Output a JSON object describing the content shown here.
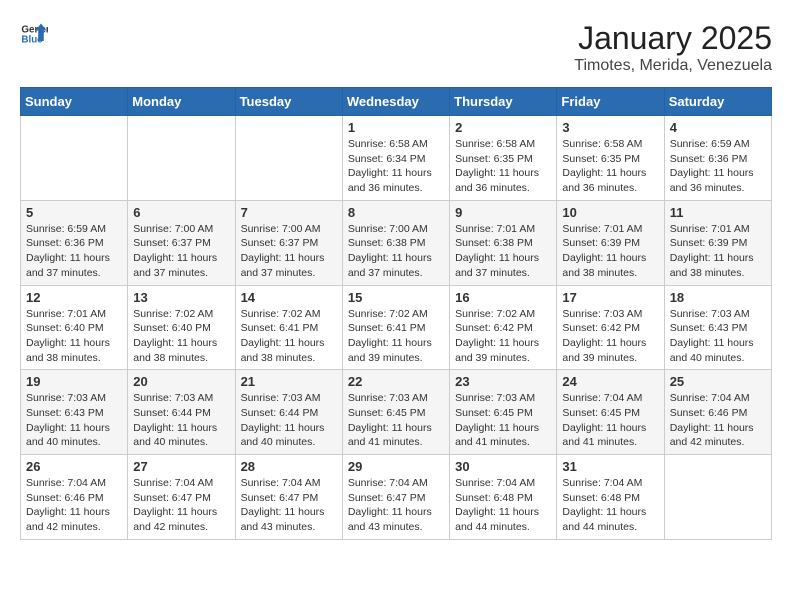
{
  "header": {
    "logo_general": "General",
    "logo_blue": "Blue",
    "month": "January 2025",
    "location": "Timotes, Merida, Venezuela"
  },
  "days_of_week": [
    "Sunday",
    "Monday",
    "Tuesday",
    "Wednesday",
    "Thursday",
    "Friday",
    "Saturday"
  ],
  "weeks": [
    [
      {
        "day": "",
        "info": ""
      },
      {
        "day": "",
        "info": ""
      },
      {
        "day": "",
        "info": ""
      },
      {
        "day": "1",
        "info": "Sunrise: 6:58 AM\nSunset: 6:34 PM\nDaylight: 11 hours and 36 minutes."
      },
      {
        "day": "2",
        "info": "Sunrise: 6:58 AM\nSunset: 6:35 PM\nDaylight: 11 hours and 36 minutes."
      },
      {
        "day": "3",
        "info": "Sunrise: 6:58 AM\nSunset: 6:35 PM\nDaylight: 11 hours and 36 minutes."
      },
      {
        "day": "4",
        "info": "Sunrise: 6:59 AM\nSunset: 6:36 PM\nDaylight: 11 hours and 36 minutes."
      }
    ],
    [
      {
        "day": "5",
        "info": "Sunrise: 6:59 AM\nSunset: 6:36 PM\nDaylight: 11 hours and 37 minutes."
      },
      {
        "day": "6",
        "info": "Sunrise: 7:00 AM\nSunset: 6:37 PM\nDaylight: 11 hours and 37 minutes."
      },
      {
        "day": "7",
        "info": "Sunrise: 7:00 AM\nSunset: 6:37 PM\nDaylight: 11 hours and 37 minutes."
      },
      {
        "day": "8",
        "info": "Sunrise: 7:00 AM\nSunset: 6:38 PM\nDaylight: 11 hours and 37 minutes."
      },
      {
        "day": "9",
        "info": "Sunrise: 7:01 AM\nSunset: 6:38 PM\nDaylight: 11 hours and 37 minutes."
      },
      {
        "day": "10",
        "info": "Sunrise: 7:01 AM\nSunset: 6:39 PM\nDaylight: 11 hours and 38 minutes."
      },
      {
        "day": "11",
        "info": "Sunrise: 7:01 AM\nSunset: 6:39 PM\nDaylight: 11 hours and 38 minutes."
      }
    ],
    [
      {
        "day": "12",
        "info": "Sunrise: 7:01 AM\nSunset: 6:40 PM\nDaylight: 11 hours and 38 minutes."
      },
      {
        "day": "13",
        "info": "Sunrise: 7:02 AM\nSunset: 6:40 PM\nDaylight: 11 hours and 38 minutes."
      },
      {
        "day": "14",
        "info": "Sunrise: 7:02 AM\nSunset: 6:41 PM\nDaylight: 11 hours and 38 minutes."
      },
      {
        "day": "15",
        "info": "Sunrise: 7:02 AM\nSunset: 6:41 PM\nDaylight: 11 hours and 39 minutes."
      },
      {
        "day": "16",
        "info": "Sunrise: 7:02 AM\nSunset: 6:42 PM\nDaylight: 11 hours and 39 minutes."
      },
      {
        "day": "17",
        "info": "Sunrise: 7:03 AM\nSunset: 6:42 PM\nDaylight: 11 hours and 39 minutes."
      },
      {
        "day": "18",
        "info": "Sunrise: 7:03 AM\nSunset: 6:43 PM\nDaylight: 11 hours and 40 minutes."
      }
    ],
    [
      {
        "day": "19",
        "info": "Sunrise: 7:03 AM\nSunset: 6:43 PM\nDaylight: 11 hours and 40 minutes."
      },
      {
        "day": "20",
        "info": "Sunrise: 7:03 AM\nSunset: 6:44 PM\nDaylight: 11 hours and 40 minutes."
      },
      {
        "day": "21",
        "info": "Sunrise: 7:03 AM\nSunset: 6:44 PM\nDaylight: 11 hours and 40 minutes."
      },
      {
        "day": "22",
        "info": "Sunrise: 7:03 AM\nSunset: 6:45 PM\nDaylight: 11 hours and 41 minutes."
      },
      {
        "day": "23",
        "info": "Sunrise: 7:03 AM\nSunset: 6:45 PM\nDaylight: 11 hours and 41 minutes."
      },
      {
        "day": "24",
        "info": "Sunrise: 7:04 AM\nSunset: 6:45 PM\nDaylight: 11 hours and 41 minutes."
      },
      {
        "day": "25",
        "info": "Sunrise: 7:04 AM\nSunset: 6:46 PM\nDaylight: 11 hours and 42 minutes."
      }
    ],
    [
      {
        "day": "26",
        "info": "Sunrise: 7:04 AM\nSunset: 6:46 PM\nDaylight: 11 hours and 42 minutes."
      },
      {
        "day": "27",
        "info": "Sunrise: 7:04 AM\nSunset: 6:47 PM\nDaylight: 11 hours and 42 minutes."
      },
      {
        "day": "28",
        "info": "Sunrise: 7:04 AM\nSunset: 6:47 PM\nDaylight: 11 hours and 43 minutes."
      },
      {
        "day": "29",
        "info": "Sunrise: 7:04 AM\nSunset: 6:47 PM\nDaylight: 11 hours and 43 minutes."
      },
      {
        "day": "30",
        "info": "Sunrise: 7:04 AM\nSunset: 6:48 PM\nDaylight: 11 hours and 44 minutes."
      },
      {
        "day": "31",
        "info": "Sunrise: 7:04 AM\nSunset: 6:48 PM\nDaylight: 11 hours and 44 minutes."
      },
      {
        "day": "",
        "info": ""
      }
    ]
  ]
}
